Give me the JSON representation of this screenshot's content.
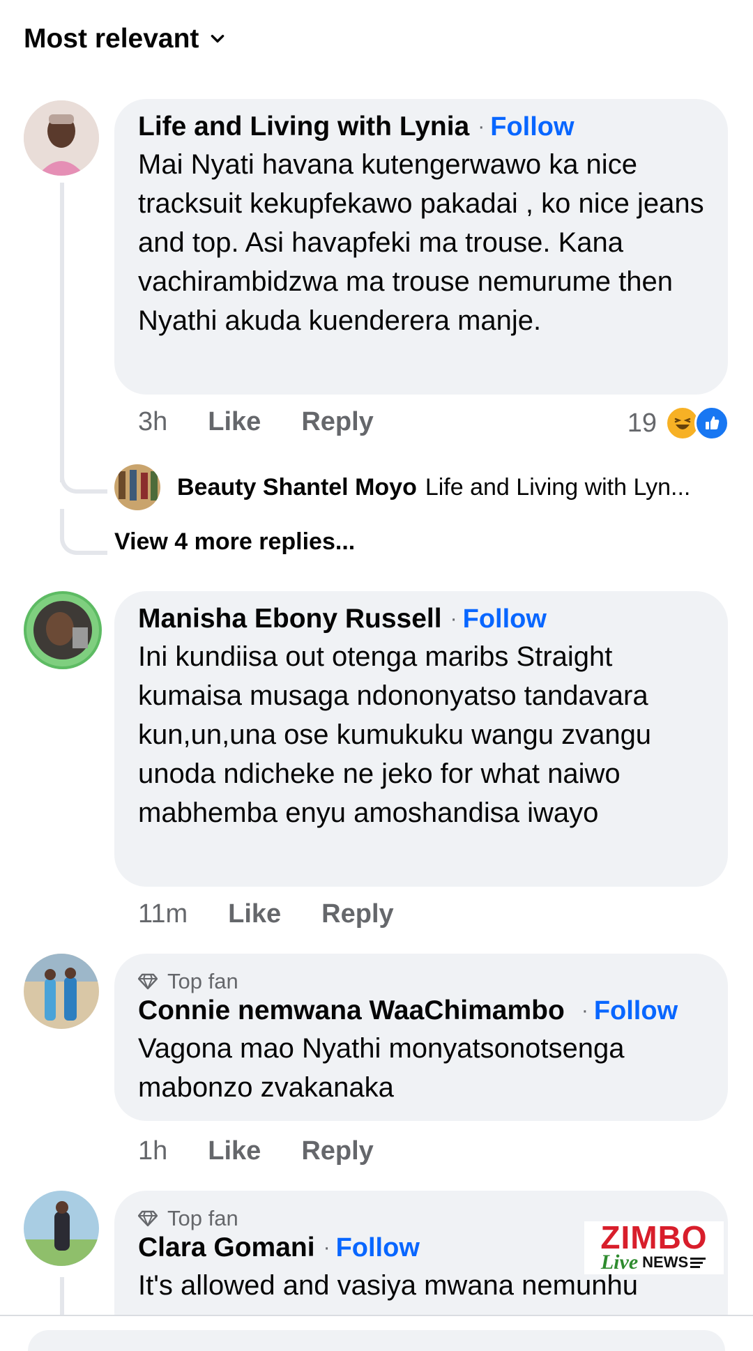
{
  "sort": {
    "label": "Most relevant"
  },
  "comments": [
    {
      "author": "Life and Living with Lynia",
      "follow": "Follow",
      "text": "Mai Nyati havana kutengerwawo ka nice tracksuit kekupfekawo pakadai , ko nice jeans and top. Asi havapfeki ma trouse. Kana vachirambidzwa ma trouse nemurume then Nyathi akuda kuenderera manje.",
      "time": "3h",
      "like": "Like",
      "reply": "Reply",
      "reaction_count": "19",
      "reaction_icons": [
        "haha-icon",
        "like-icon"
      ],
      "replies": {
        "preview_author": "Beauty Shantel Moyo",
        "preview_text": "Life and Living with Lyn...",
        "view_more": "View 4 more replies..."
      }
    },
    {
      "author": "Manisha Ebony Russell",
      "follow": "Follow",
      "text": "Ini kundiisa out otenga maribs Straight kumaisa musaga ndononyatso tandavara kun,un,una ose kumukuku wangu zvangu  unoda ndicheke ne jeko for what naiwo mabhemba enyu amoshandisa iwayo",
      "time": "11m",
      "like": "Like",
      "reply": "Reply"
    },
    {
      "badge": "Top fan",
      "author": "Connie nemwana WaaChimambo",
      "follow": "Follow",
      "text": "Vagona mao Nyathi monyatsonotsenga mabonzo zvakanaka",
      "time": "1h",
      "like": "Like",
      "reply": "Reply"
    },
    {
      "badge": "Top fan",
      "author": "Clara Gomani",
      "follow": "Follow",
      "text": "It's allowed  and vasiya mwana nemunhu"
    }
  ],
  "watermark": {
    "line1": "ZIMBO",
    "line2a": "Live",
    "line2b": "NEWS"
  },
  "colors": {
    "accent": "#0866ff",
    "bubble": "#f0f2f5",
    "muted": "#65676b"
  }
}
